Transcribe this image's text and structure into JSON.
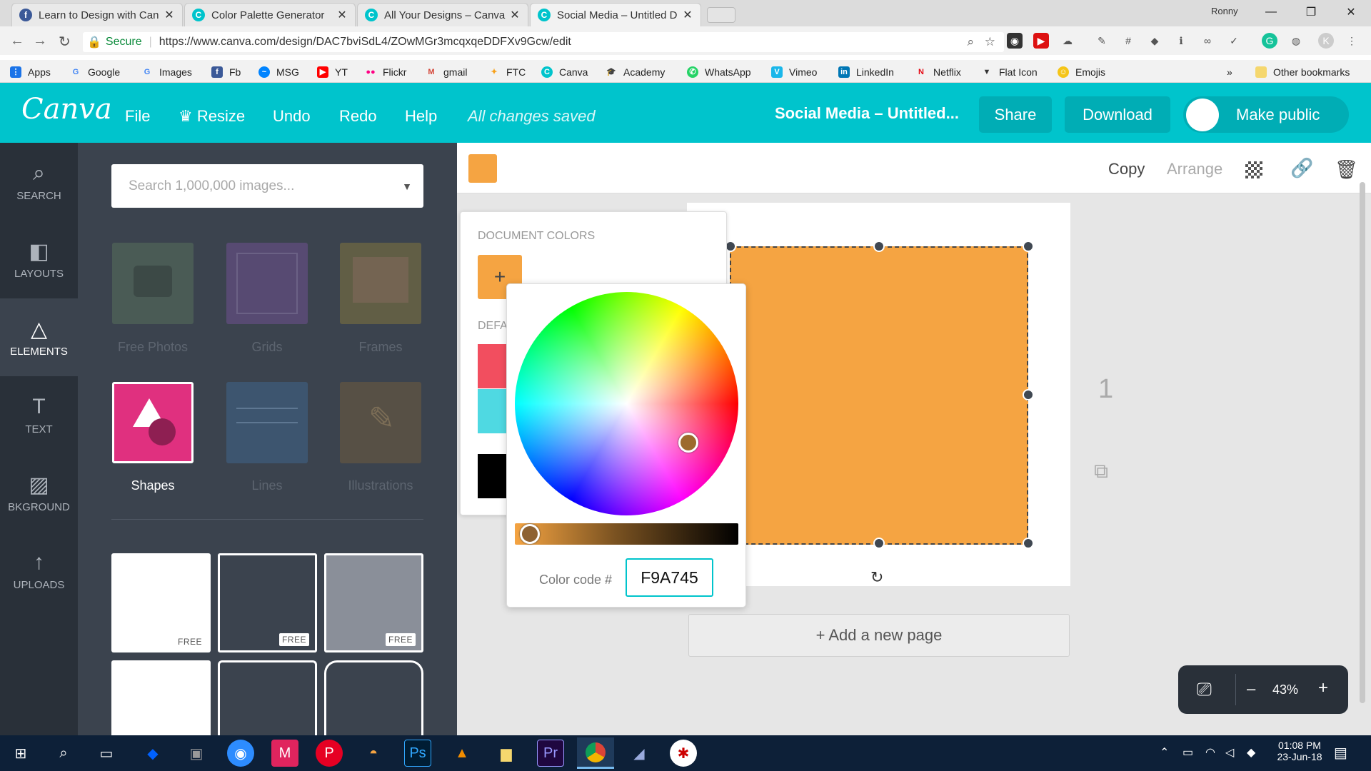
{
  "browser": {
    "tabs": [
      {
        "title": "Learn to Design with Can",
        "color": "#3b5998",
        "glyph": "f"
      },
      {
        "title": "Color Palette Generator",
        "color": "#00c4cc",
        "glyph": "C"
      },
      {
        "title": "All Your Designs – Canva",
        "color": "#00c4cc",
        "glyph": "C"
      },
      {
        "title": "Social Media – Untitled D",
        "color": "#00c4cc",
        "glyph": "C"
      }
    ],
    "profile": "Ronny",
    "secure_label": "Secure",
    "url": "https://www.canva.com/design/DAC7bviSdL4/ZOwMGr3mcqxqeDDFXv9Gcw/edit",
    "bookmarks": [
      {
        "label": "Apps",
        "color": "#e0463a"
      },
      {
        "label": "Google",
        "color": "#4285f4"
      },
      {
        "label": "Images",
        "color": "#4285f4"
      },
      {
        "label": "Fb",
        "color": "#3b5998"
      },
      {
        "label": "MSG",
        "color": "#0084ff"
      },
      {
        "label": "YT",
        "color": "#ff0000"
      },
      {
        "label": "Flickr",
        "color": "#ff0084"
      },
      {
        "label": "gmail",
        "color": "#d44638"
      },
      {
        "label": "FTC",
        "color": "#f7a11a"
      },
      {
        "label": "Canva",
        "color": "#00c4cc"
      },
      {
        "label": "Academy",
        "color": "#222222"
      },
      {
        "label": "WhatsApp",
        "color": "#25d366"
      },
      {
        "label": "Vimeo",
        "color": "#1ab7ea"
      },
      {
        "label": "LinkedIn",
        "color": "#0077b5"
      },
      {
        "label": "Netflix",
        "color": "#e50914"
      },
      {
        "label": "Flat Icon",
        "color": "#333333"
      },
      {
        "label": "Emojis",
        "color": "#f5c518"
      }
    ],
    "more_label": "»",
    "other_bookmarks": "Other bookmarks"
  },
  "header": {
    "logo": "Canva",
    "menu": [
      "File",
      "Resize",
      "Undo",
      "Redo",
      "Help"
    ],
    "status": "All changes saved",
    "title": "Social Media – Untitled...",
    "share": "Share",
    "download": "Download",
    "make_public": "Make public",
    "accent": "#00c4cc"
  },
  "rail": [
    {
      "label": "SEARCH",
      "icon": "search-icon",
      "glyph": "⌕"
    },
    {
      "label": "LAYOUTS",
      "icon": "layouts-icon",
      "glyph": "◧"
    },
    {
      "label": "ELEMENTS",
      "icon": "elements-icon",
      "glyph": "△"
    },
    {
      "label": "TEXT",
      "icon": "text-icon",
      "glyph": "T"
    },
    {
      "label": "BKGROUND",
      "icon": "background-icon",
      "glyph": "▨"
    },
    {
      "label": "UPLOADS",
      "icon": "upload-icon",
      "glyph": "↑"
    }
  ],
  "panel": {
    "search_placeholder": "Search 1,000,000 images...",
    "categories": [
      "Free Photos",
      "Grids",
      "Frames",
      "Shapes",
      "Lines",
      "Illustrations"
    ],
    "free_label": "FREE"
  },
  "toolbar": {
    "copy": "Copy",
    "arrange": "Arrange",
    "selected_color": "#f5a442"
  },
  "doc_colors": {
    "title": "DOCUMENT COLORS",
    "default_title": "DEFA",
    "add": "+"
  },
  "picker": {
    "label": "Color code #",
    "value": "F9A745"
  },
  "canvas": {
    "page_number": "1",
    "shape_color": "#f5a442",
    "add_page": "+ Add a new page"
  },
  "zoom": {
    "level": "43%",
    "minus": "–",
    "plus": "+"
  },
  "taskbar": {
    "time": "01:08 PM",
    "date": "23-Jun-18"
  }
}
